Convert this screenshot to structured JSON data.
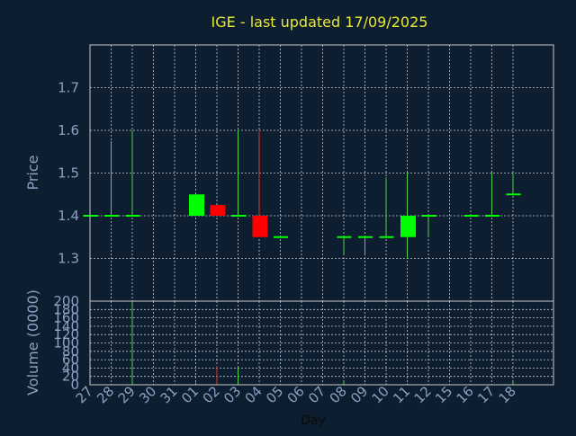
{
  "chart_data": {
    "type": "candlestick",
    "title": "IGE - last updated 17/09/2025",
    "xlabel": "Day",
    "price_panel": {
      "ylabel": "Price",
      "ylim": [
        1.2,
        1.8
      ],
      "yticks": [
        1.3,
        1.4,
        1.5,
        1.6,
        1.7
      ],
      "grid": true
    },
    "volume_panel": {
      "ylabel": "Volume (0000)",
      "ylim": [
        0,
        200
      ],
      "yticks": [
        0,
        20,
        40,
        60,
        80,
        100,
        120,
        140,
        160,
        180,
        200
      ],
      "grid": true
    },
    "x_tick_labels": [
      "27",
      "28",
      "29",
      "30",
      "31",
      "01",
      "02",
      "03",
      "04",
      "05",
      "06",
      "07",
      "08",
      "09",
      "10",
      "11",
      "12",
      "15",
      "16",
      "17",
      "18"
    ],
    "candles": [
      {
        "i": 0,
        "open": 1.4,
        "high": 1.4,
        "low": 1.4,
        "close": 1.4,
        "volume": 0
      },
      {
        "i": 1,
        "open": 1.4,
        "high": 1.575,
        "low": 1.4,
        "close": 1.4,
        "volume": 0
      },
      {
        "i": 2,
        "open": 1.4,
        "high": 1.6,
        "low": 1.4,
        "close": 1.4,
        "volume": 200
      },
      {
        "i": 5,
        "open": 1.4,
        "high": 1.45,
        "low": 1.4,
        "close": 1.45,
        "volume": 5
      },
      {
        "i": 6,
        "open": 1.425,
        "high": 1.425,
        "low": 1.4,
        "close": 1.4,
        "volume": 45
      },
      {
        "i": 7,
        "open": 1.4,
        "high": 1.6,
        "low": 1.4,
        "close": 1.4,
        "volume": 40
      },
      {
        "i": 8,
        "open": 1.4,
        "high": 1.6,
        "low": 1.35,
        "close": 1.35,
        "volume": 0
      },
      {
        "i": 9,
        "open": 1.35,
        "high": 1.35,
        "low": 1.35,
        "close": 1.35,
        "volume": 0
      },
      {
        "i": 12,
        "open": 1.35,
        "high": 1.35,
        "low": 1.31,
        "close": 1.35,
        "volume": 8
      },
      {
        "i": 13,
        "open": 1.35,
        "high": 1.35,
        "low": 1.31,
        "close": 1.35,
        "volume": 3
      },
      {
        "i": 14,
        "open": 1.35,
        "high": 1.49,
        "low": 1.35,
        "close": 1.35,
        "volume": 4
      },
      {
        "i": 15,
        "open": 1.35,
        "high": 1.5,
        "low": 1.3,
        "close": 1.4,
        "volume": 3
      },
      {
        "i": 16,
        "open": 1.4,
        "high": 1.4,
        "low": 1.35,
        "close": 1.4,
        "volume": 2
      },
      {
        "i": 18,
        "open": 1.4,
        "high": 1.4,
        "low": 1.4,
        "close": 1.4,
        "volume": 0
      },
      {
        "i": 19,
        "open": 1.4,
        "high": 1.5,
        "low": 1.4,
        "close": 1.4,
        "volume": 2
      },
      {
        "i": 20,
        "open": 1.45,
        "high": 1.5,
        "low": 1.45,
        "close": 1.45,
        "volume": 8
      }
    ],
    "colors": {
      "background": "#0e1e31",
      "grid": "#c8c8c8",
      "axis_text": "#8aa0c0",
      "title": "#e8e830",
      "up": "#00ff00",
      "down": "#ff0000",
      "up_wick": "#4fd24f",
      "down_wick": "#e03030"
    }
  }
}
